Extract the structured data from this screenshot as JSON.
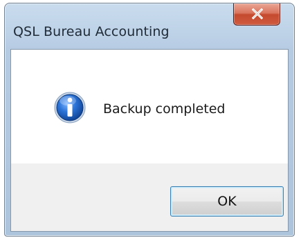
{
  "window": {
    "title": "QSL Bureau Accounting"
  },
  "dialog": {
    "icon": "info-icon",
    "message": "Backup completed",
    "ok_label": "OK"
  },
  "colors": {
    "close_button": "#c9553a",
    "frame": "#bfd3e8",
    "button_border": "#3c7fb1",
    "button_bar": "#f0f0f0",
    "info_icon": "#1b5fbf"
  }
}
